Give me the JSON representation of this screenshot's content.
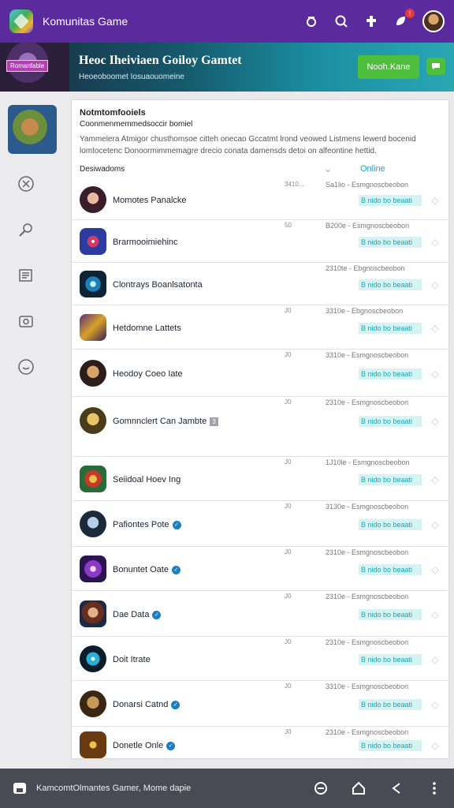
{
  "app": {
    "title": "Komunitas Game"
  },
  "topbar": {
    "notification_count": "!"
  },
  "banner": {
    "tag": "Romanfable",
    "title": "Heoc Iheiviaen Goiloy Gamtet",
    "subtitle": "Heoeoboomet Iosuaouomeine",
    "button_label": "Nooh.Kane",
    "colors": {
      "button": "#4fbe3c"
    }
  },
  "panel": {
    "title": "Notmtomfooiels",
    "subtitle": "Coonmenmemmedsoccir bomiel",
    "description": "Yammelera Atmigor chusthomsoe citteh onecao Gccatmt lrond veowed Listmens lewerd bocenid lomtocetenc Donoormimmemagre drecio conata damensds detoi on alfeontine hettid.",
    "filter_label": "Desiwadoms",
    "filter_online": "Online"
  },
  "games": [
    {
      "name": "Momotes Panalcke",
      "num": "3410...",
      "meta": "Sa1lio - Esmgnoscbeobon",
      "status": "B nido bo beaati",
      "verified": false,
      "tag": ""
    },
    {
      "name": "Brarmooimiehinc",
      "num": "50",
      "meta": "B200e - Esmgnoscbeobon",
      "status": "B nido bo beaati",
      "verified": false,
      "tag": ""
    },
    {
      "name": "Clontrays Boanlsatonta",
      "num": "",
      "meta": "2310te - Ebgnoscbeobon",
      "status": "B nido bo beaati",
      "verified": false,
      "tag": ""
    },
    {
      "name": "Hetdomne Lattets",
      "num": "J0",
      "meta": "3310e - Ebgnoscbeobon",
      "status": "B nido bo beaati",
      "verified": false,
      "tag": ""
    },
    {
      "name": "Heodoy Coeo Iate",
      "num": "J0",
      "meta": "3310e - Esmgnoscbeobon",
      "status": "B nido bo beaati",
      "verified": false,
      "tag": ""
    },
    {
      "name": "Gomnnclert Can Jambte",
      "num": "J0",
      "meta": "2310e - Esmgnoscbeobon",
      "status": "B nido bo beaati",
      "verified": false,
      "tag": "3"
    },
    {
      "name": "Seiidoal Hoev Ing",
      "num": "J0",
      "meta": "1J10le - Esmgnoscbeobon",
      "status": "B nido bo beaati",
      "verified": false,
      "tag": ""
    },
    {
      "name": "Pafiontes Pote",
      "num": "J0",
      "meta": "3130e - Esmgnoscbeobon",
      "status": "B nido bo beaati",
      "verified": true,
      "tag": ""
    },
    {
      "name": "Bonuntet Oate",
      "num": "J0",
      "meta": "2310e - Esmgnoscbeobon",
      "status": "B nido bo beaati",
      "verified": true,
      "tag": ""
    },
    {
      "name": "Dae Data",
      "num": "J0",
      "meta": "2310e - Esmgnoscbeobon",
      "status": "B nido bo beaati",
      "verified": true,
      "tag": ""
    },
    {
      "name": "Doit Itrate",
      "num": "J0",
      "meta": "2310e - Esmgnoscbeobon",
      "status": "B nido bo beaati",
      "verified": false,
      "tag": ""
    },
    {
      "name": "Donarsi Catnd",
      "num": "J0",
      "meta": "3310e - Esmgnoscbeobon",
      "status": "B nido bo beaati",
      "verified": true,
      "tag": ""
    },
    {
      "name": "Donetle Onle",
      "num": "J0",
      "meta": "2310e - Esmgnoscbeobon",
      "status": "B nido bo beaati",
      "verified": true,
      "tag": ""
    }
  ],
  "bottombar": {
    "text": "KamcomtOlmantes Gamer, Mome dapie"
  },
  "colors": {
    "topbar": "#5b2a9c",
    "accent": "#1fa2c8",
    "status_bg": "#d5f3f2"
  }
}
